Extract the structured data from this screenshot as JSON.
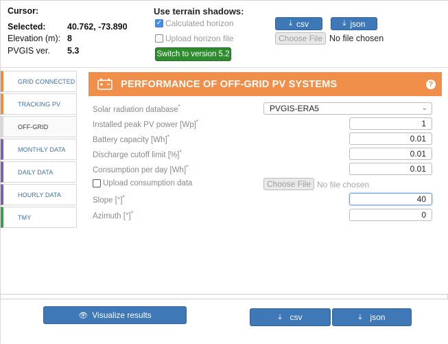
{
  "info": {
    "cursor_label": "Cursor:",
    "selected_label": "Selected:",
    "selected_value": "40.762, -73.890",
    "elevation_label": "Elevation (m):",
    "elevation_value": "8",
    "pvgis_label": "PVGIS ver.",
    "pvgis_value": "5.3"
  },
  "terrain": {
    "title": "Use terrain shadows:",
    "calculated_label": "Calculated horizon",
    "calculated_checked": true,
    "upload_label": "Upload horizon file",
    "upload_checked": false,
    "switch_label": "Switch to version 5.2"
  },
  "top_downloads": {
    "csv_label": "csv",
    "json_label": "json",
    "choose_file_label": "Choose File",
    "no_file_text": "No file chosen"
  },
  "tabs": [
    {
      "label": "GRID CONNECTED",
      "accent": "orange"
    },
    {
      "label": "TRACKING PV",
      "accent": "orange"
    },
    {
      "label": "OFF-GRID",
      "accent": "active"
    },
    {
      "label": "MONTHLY DATA",
      "accent": "purple"
    },
    {
      "label": "DAILY DATA",
      "accent": "purple"
    },
    {
      "label": "HOURLY DATA",
      "accent": "purple"
    },
    {
      "label": "TMY",
      "accent": "green"
    }
  ],
  "panel": {
    "title": "PERFORMANCE OF OFF-GRID PV SYSTEMS",
    "help": "?",
    "accent_color": "#ef8f4a"
  },
  "form": {
    "radiation_db_label": "Solar radiation database",
    "radiation_db_value": "PVGIS-ERA5",
    "peak_power_label": "Installed peak PV power [Wp]",
    "peak_power_value": "1",
    "battery_label": "Battery capacity [Wh]",
    "battery_value": "0.01",
    "discharge_label": "Discharge cutoff limit [%]",
    "discharge_value": "0.01",
    "consumption_label": "Consumption per day [Wh]",
    "consumption_value": "0.01",
    "upload_consumption_label": "Upload consumption data",
    "upload_consumption_checked": false,
    "choose_file_label": "Choose File",
    "no_file_text": "No file chosen",
    "slope_label": "Slope [°]",
    "slope_value": "40",
    "azimuth_label": "Azimuth [°]",
    "azimuth_value": "0",
    "required_mark": "*"
  },
  "bottom": {
    "visualize_label": "Visualize results",
    "csv_label": "csv",
    "json_label": "json"
  },
  "colors": {
    "primary_blue": "#3e78b7",
    "switch_green": "#2e8b2e"
  }
}
